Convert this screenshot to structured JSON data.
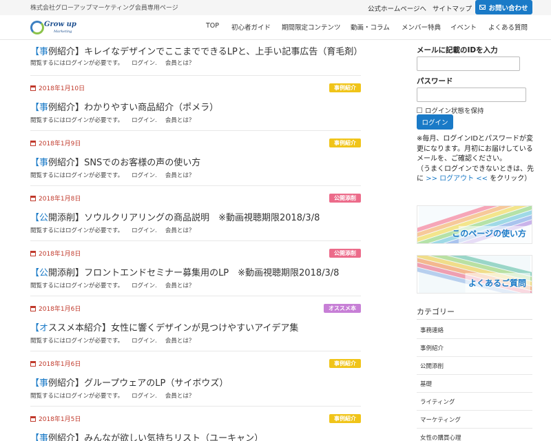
{
  "topbar": {
    "company": "株式会社グローアップマーケティング会員専用ページ",
    "links": [
      "公式ホームページへ",
      "サイトマップ"
    ],
    "contact_label": "お問い合わせ"
  },
  "header": {
    "logo_text": "Grow up",
    "logo_sub": "Marketing",
    "nav": [
      "TOP",
      "初心者ガイド",
      "期間限定コンテンツ",
      "動画・コラム",
      "メンバー特典",
      "イベント",
      "よくある質問"
    ]
  },
  "posts": [
    {
      "date": "",
      "badge": "",
      "title_first": "事",
      "title_cat": "例紹介",
      "title_rest": "キレイなデザインでここまでできるLPと、上手い記事広告（育毛剤）",
      "meta": "閲覧するにはログインが必要です。",
      "login": "ログイン.",
      "whatis": "会員とは？"
    },
    {
      "date": "2018年1月10日",
      "badge": "事例紹介",
      "title_first": "事",
      "title_cat": "例紹介",
      "title_rest": "わかりやすい商品紹介（ポメラ）",
      "meta": "閲覧するにはログインが必要です。",
      "login": "ログイン.",
      "whatis": "会員とは？"
    },
    {
      "date": "2018年1月9日",
      "badge": "事例紹介",
      "title_first": "事",
      "title_cat": "例紹介",
      "title_rest": "SNSでのお客様の声の使い方",
      "meta": "閲覧するにはログインが必要です。",
      "login": "ログイン.",
      "whatis": "会員とは？"
    },
    {
      "date": "2018年1月8日",
      "badge": "公開添削",
      "title_first": "公",
      "title_cat": "開添削",
      "title_rest": "ソウルクリアリングの商品説明　※動画視聴期限2018/3/8",
      "meta": "閲覧するにはログインが必要です。",
      "login": "ログイン.",
      "whatis": "会員とは？"
    },
    {
      "date": "2018年1月8日",
      "badge": "公開添削",
      "title_first": "公",
      "title_cat": "開添削",
      "title_rest": "フロントエンドセミナー募集用のLP　※動画視聴期限2018/3/8",
      "meta": "閲覧するにはログインが必要です。",
      "login": "ログイン.",
      "whatis": "会員とは？"
    },
    {
      "date": "2018年1月6日",
      "badge": "オススメ本",
      "title_first": "オ",
      "title_cat": "ススメ本紹介",
      "title_rest": "女性に響くデザインが見つけやすいアイデア集",
      "meta": "閲覧するにはログインが必要です。",
      "login": "ログイン.",
      "whatis": "会員とは？"
    },
    {
      "date": "2018年1月6日",
      "badge": "事例紹介",
      "title_first": "事",
      "title_cat": "例紹介",
      "title_rest": "グループウェアのLP（サイボウズ）",
      "meta": "閲覧するにはログインが必要です。",
      "login": "ログイン.",
      "whatis": "会員とは？"
    },
    {
      "date": "2018年1月5日",
      "badge": "事例紹介",
      "title_first": "事",
      "title_cat": "例紹介",
      "title_rest": "みんなが欲しい気持ちリスト（ユーキャン）",
      "meta": "",
      "login": "",
      "whatis": ""
    }
  ],
  "badge_colors": {
    "事例紹介": "#f0c419",
    "公開添削": "#ec6b8a",
    "オススメ本": "#c77fd6"
  },
  "sidebar": {
    "id_label": "メールに記載のIDを入力",
    "password_label": "パスワード",
    "remember_label": "ログイン状態を保持",
    "login_button": "ログイン",
    "notice_1": "※毎月、ログインIDとパスワードが変更になります。月初にお届けしているメールを、ご確認ください。",
    "notice_2": "（うまくログインできないときは、先に",
    "logout_link": ">> ログアウト <<",
    "notice_3": "をクリック）",
    "banner_1": "このページの使い方",
    "banner_2": "よくあるご質問",
    "category_title": "カテゴリー",
    "categories": [
      "事務連絡",
      "事例紹介",
      "公開添削",
      "基礎",
      "ライティング",
      "マーケティング",
      "女性の購買心理"
    ]
  },
  "colors": {
    "accent": "#1a7ac7",
    "date": "#c0392b"
  }
}
